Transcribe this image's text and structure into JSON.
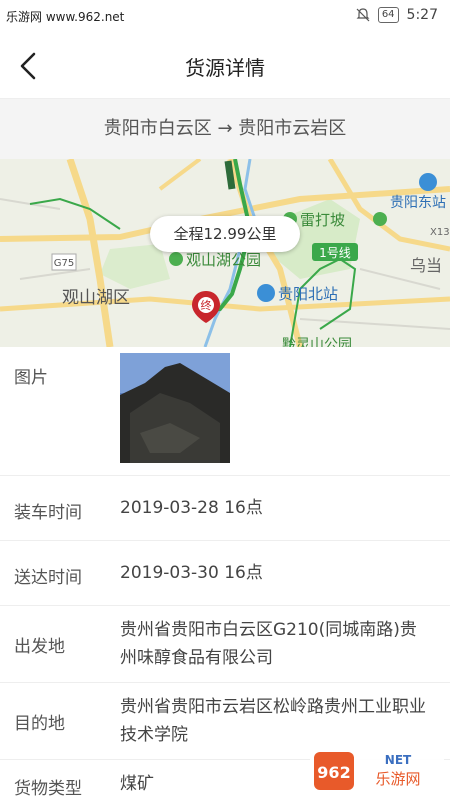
{
  "status_bar": {
    "site": "乐游网 www.962.net",
    "battery": "64",
    "time": "5:27"
  },
  "nav": {
    "title": "货源详情"
  },
  "route": {
    "text": "贵阳市白云区 → 贵阳市云岩区"
  },
  "map": {
    "distance": "全程12.99公里",
    "labels": {
      "road_g75": "G75",
      "guanshan_lake": "观山湖区",
      "guanshan_park": "观山湖公园",
      "leidapo": "雷打坡",
      "line1": "1号线",
      "guiyang_north": "贵阳北站",
      "guiyang_east": "贵阳东站",
      "wudang": "乌当",
      "x13": "X13",
      "qianling": "黔灵山公园",
      "end_marker": "终"
    }
  },
  "details": {
    "picture_label": "图片",
    "load_time_label": "装车时间",
    "load_time": "2019-03-28 16点",
    "arrive_time_label": "送达时间",
    "arrive_time": "2019-03-30 16点",
    "origin_label": "出发地",
    "origin": "贵州省贵阳市白云区G210(同城南路)贵州味醇食品有限公司",
    "dest_label": "目的地",
    "dest": "贵州省贵阳市云岩区松岭路贵州工业职业技术学院",
    "cargo_label": "货物类型",
    "cargo": "煤矿"
  },
  "watermark": {
    "text": "962",
    "sub": "乐游网",
    "net": "NET"
  },
  "colors": {
    "route_green": "#3aa84a",
    "marker_red": "#c8262c",
    "road_yellow": "#f6d98a"
  }
}
